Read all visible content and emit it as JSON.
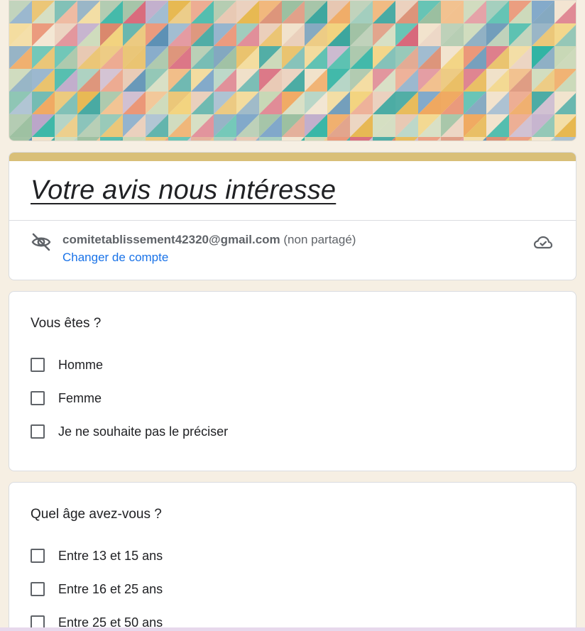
{
  "form": {
    "title": "Votre avis nous intéresse",
    "accent_color": "#d9bf78",
    "background_color": "#f6efe3"
  },
  "account": {
    "email": "comitetablissement42320@gmail.com",
    "sharing_note": "(non partagé)",
    "switch_label": "Changer de compte",
    "hidden_icon": "eye-off-icon",
    "save_icon": "cloud-check-icon",
    "link_color": "#1a73e8"
  },
  "questions": [
    {
      "title": "Vous êtes ?",
      "options": [
        "Homme",
        "Femme",
        "Je ne souhaite pas le préciser"
      ]
    },
    {
      "title": "Quel âge avez-vous ?",
      "options": [
        "Entre 13 et 15 ans",
        "Entre 16 et 25 ans",
        "Entre 25 et 50 ans"
      ]
    }
  ]
}
